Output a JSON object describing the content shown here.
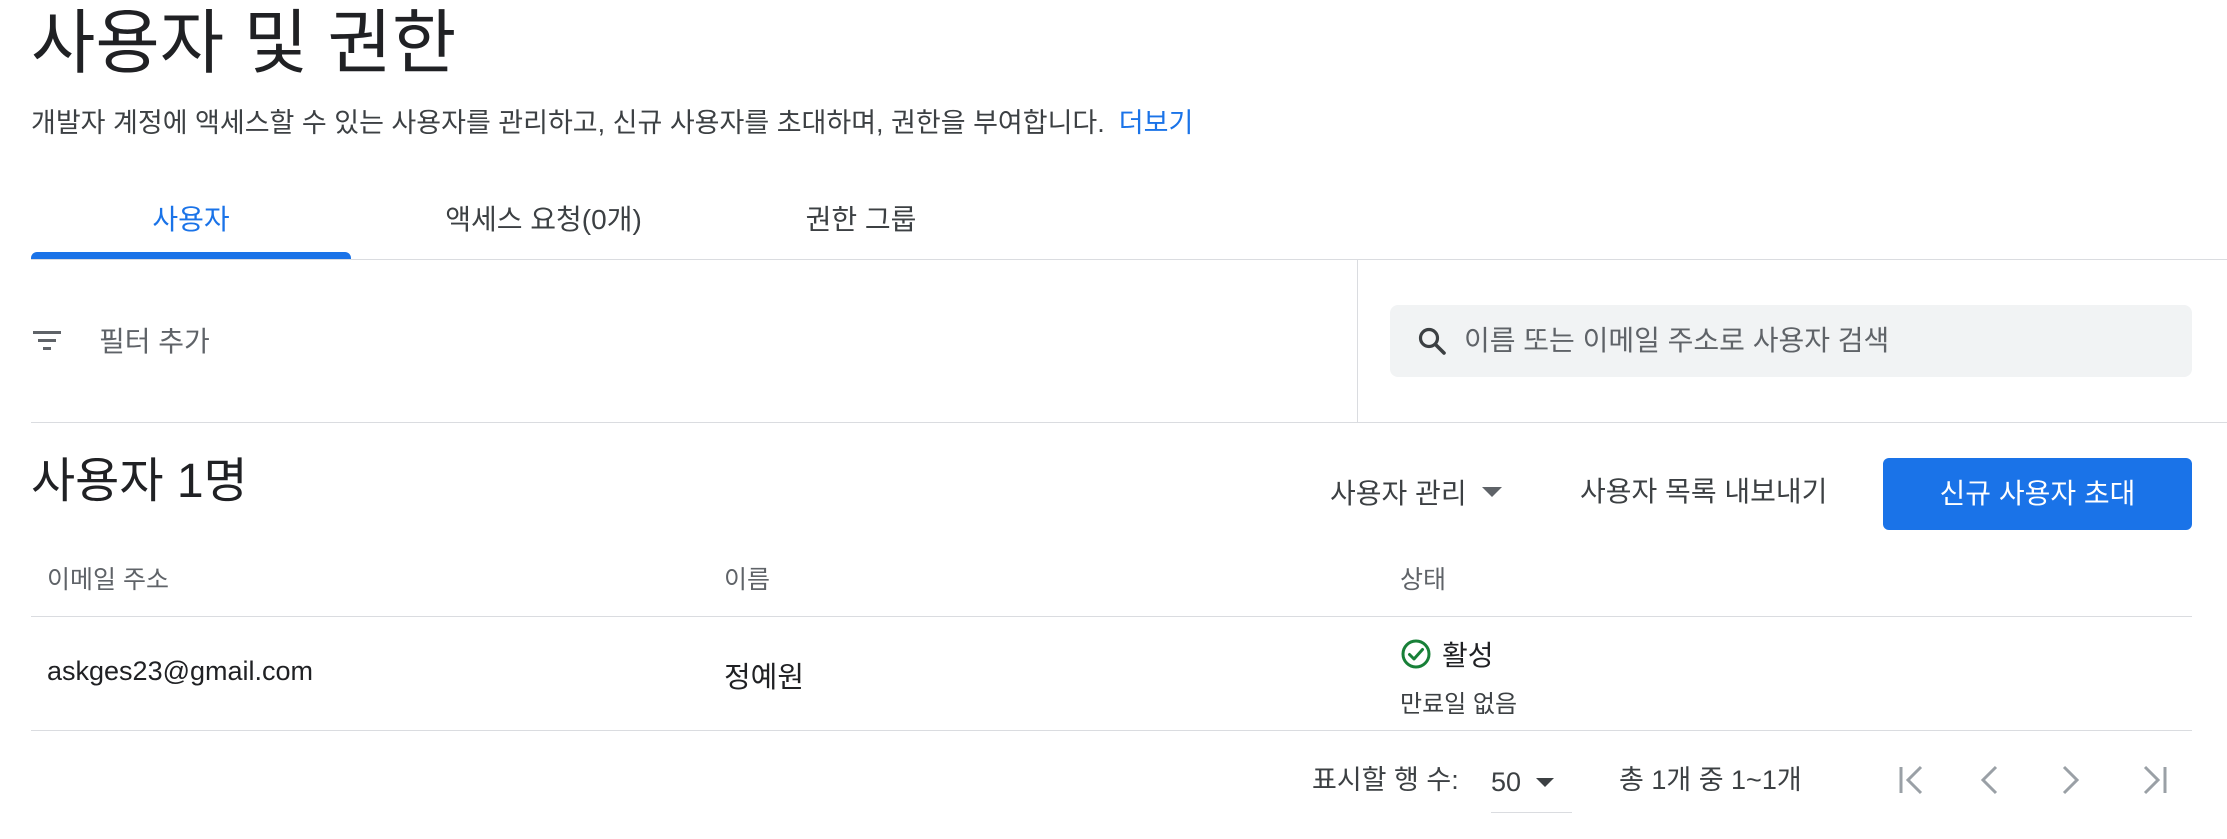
{
  "page": {
    "title": "사용자 및 권한",
    "description": "개발자 계정에 액세스할 수 있는 사용자를 관리하고, 신규 사용자를 초대하며, 권한을 부여합니다.",
    "learn_more": "더보기"
  },
  "tabs": [
    {
      "label": "사용자",
      "active": true
    },
    {
      "label": "액세스 요청(0개)",
      "active": false
    },
    {
      "label": "권한 그룹",
      "active": false
    }
  ],
  "filter": {
    "label": "필터 추가",
    "icon": "filter-icon"
  },
  "search": {
    "placeholder": "이름 또는 이메일 주소로 사용자 검색",
    "value": "",
    "icon": "search-icon"
  },
  "users_section": {
    "count_title": "사용자 1명",
    "manage_label": "사용자 관리",
    "export_label": "사용자 목록 내보내기",
    "invite_label": "신규 사용자 초대"
  },
  "table": {
    "columns": [
      "이메일 주소",
      "이름",
      "상태"
    ],
    "rows": [
      {
        "email": "askges23@gmail.com",
        "name": "정예원",
        "status": "활성",
        "expiry": "만료일 없음"
      }
    ]
  },
  "pagination": {
    "rows_label": "표시할 행 수:",
    "rows_value": "50",
    "range": "총 1개 중 1~1개"
  },
  "colors": {
    "accent": "#1a73e8",
    "success": "#188038",
    "text": "#202124",
    "muted": "#5f6368",
    "divider": "#dadce0"
  }
}
